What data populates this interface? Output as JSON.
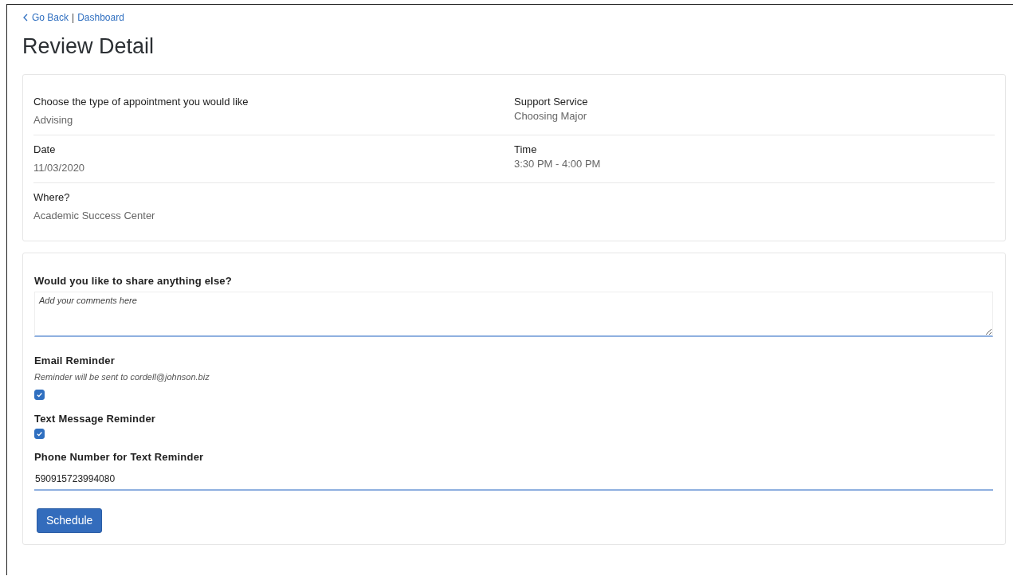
{
  "breadcrumb": {
    "back": "Go Back",
    "separator": "|",
    "link": "Dashboard"
  },
  "title": "Review Detail",
  "details": [
    {
      "items": [
        {
          "label": "Choose the type of appointment you would like",
          "value": "Advising"
        },
        {
          "label": "Support Service",
          "value": "Choosing Major"
        }
      ]
    },
    {
      "items": [
        {
          "label": "Date",
          "value": "11/03/2020"
        },
        {
          "label": "Time",
          "value": "3:30 PM - 4:00 PM"
        }
      ]
    },
    {
      "items": [
        {
          "label": "Where?",
          "value": "Academic Success Center"
        }
      ]
    }
  ],
  "comments": {
    "label": "Would you like to share anything else?",
    "placeholder": "Add your comments here"
  },
  "email_reminder": {
    "label": "Email Reminder",
    "note": "Reminder will be sent to cordell@johnson.biz",
    "checked": true
  },
  "text_reminder": {
    "label": "Text Message Reminder",
    "checked": true
  },
  "phone": {
    "label": "Phone Number for Text Reminder",
    "value": "590915723994080"
  },
  "buttons": [
    "Schedule"
  ]
}
